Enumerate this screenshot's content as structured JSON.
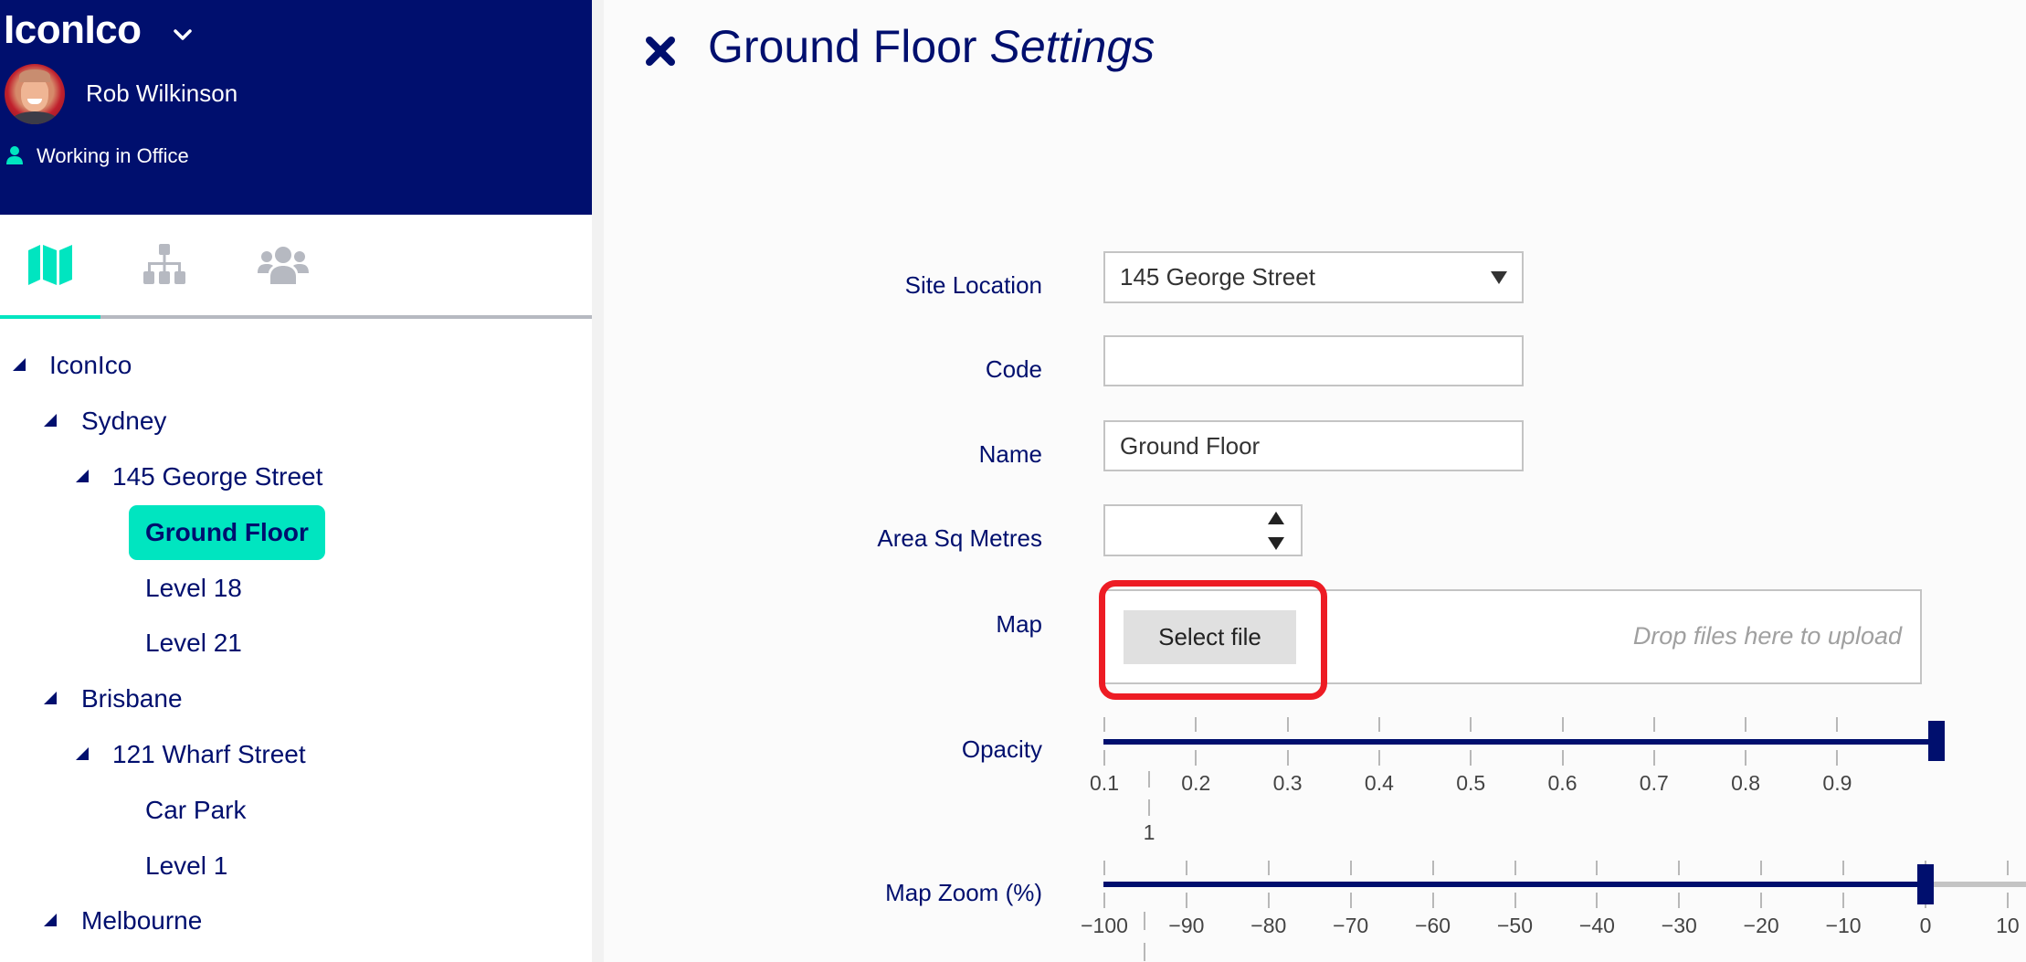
{
  "sidebar": {
    "org_name": "IconIco",
    "user": {
      "name": "Rob Wilkinson",
      "status": "Working in Office"
    },
    "tabs": [
      {
        "id": "map",
        "icon": "map-icon",
        "active": true
      },
      {
        "id": "hierarchy",
        "icon": "sitemap-icon",
        "active": false
      },
      {
        "id": "people",
        "icon": "users-icon",
        "active": false
      }
    ],
    "tree": [
      {
        "label": "IconIco",
        "level": 0,
        "expanded": true
      },
      {
        "label": "Sydney",
        "level": 1,
        "expanded": true
      },
      {
        "label": "145 George Street",
        "level": 2,
        "expanded": true
      },
      {
        "label": "Ground Floor",
        "level": 3,
        "selected": true
      },
      {
        "label": "Level 18",
        "level": 3
      },
      {
        "label": "Level 21",
        "level": 3
      },
      {
        "label": "Brisbane",
        "level": 1,
        "expanded": true
      },
      {
        "label": "121 Wharf Street",
        "level": 2,
        "expanded": true
      },
      {
        "label": "Car Park",
        "level": 3
      },
      {
        "label": "Level 1",
        "level": 3
      },
      {
        "label": "Melbourne",
        "level": 1,
        "expanded": true
      }
    ]
  },
  "main": {
    "title_plain": "Ground Floor",
    "title_italic": "Settings",
    "form": {
      "site_location": {
        "label": "Site Location",
        "value": "145 George Street"
      },
      "code": {
        "label": "Code",
        "value": ""
      },
      "name": {
        "label": "Name",
        "value": "Ground Floor"
      },
      "area": {
        "label": "Area Sq Metres",
        "value": ""
      },
      "map": {
        "label": "Map",
        "button": "Select file",
        "drop_hint": "Drop files here to upload"
      },
      "opacity": {
        "label": "Opacity",
        "min": 0.1,
        "max": 1,
        "value": 1,
        "tick_labels": [
          "0.1",
          "0.2",
          "0.3",
          "0.4",
          "0.5",
          "0.6",
          "0.7",
          "0.8",
          "0.9"
        ],
        "wrapped_label": "1"
      },
      "map_zoom": {
        "label": "Map Zoom (%)",
        "min": -100,
        "value": 0,
        "tick_labels": [
          "-100",
          "-90",
          "-80",
          "-70",
          "-60",
          "-50",
          "-40",
          "-30",
          "-20",
          "-10",
          "0",
          "10"
        ]
      }
    }
  },
  "colors": {
    "navy": "#000f6e",
    "accent": "#00e5c0",
    "highlight": "#ed1c24",
    "inactive_icon": "#b6b9c1"
  }
}
